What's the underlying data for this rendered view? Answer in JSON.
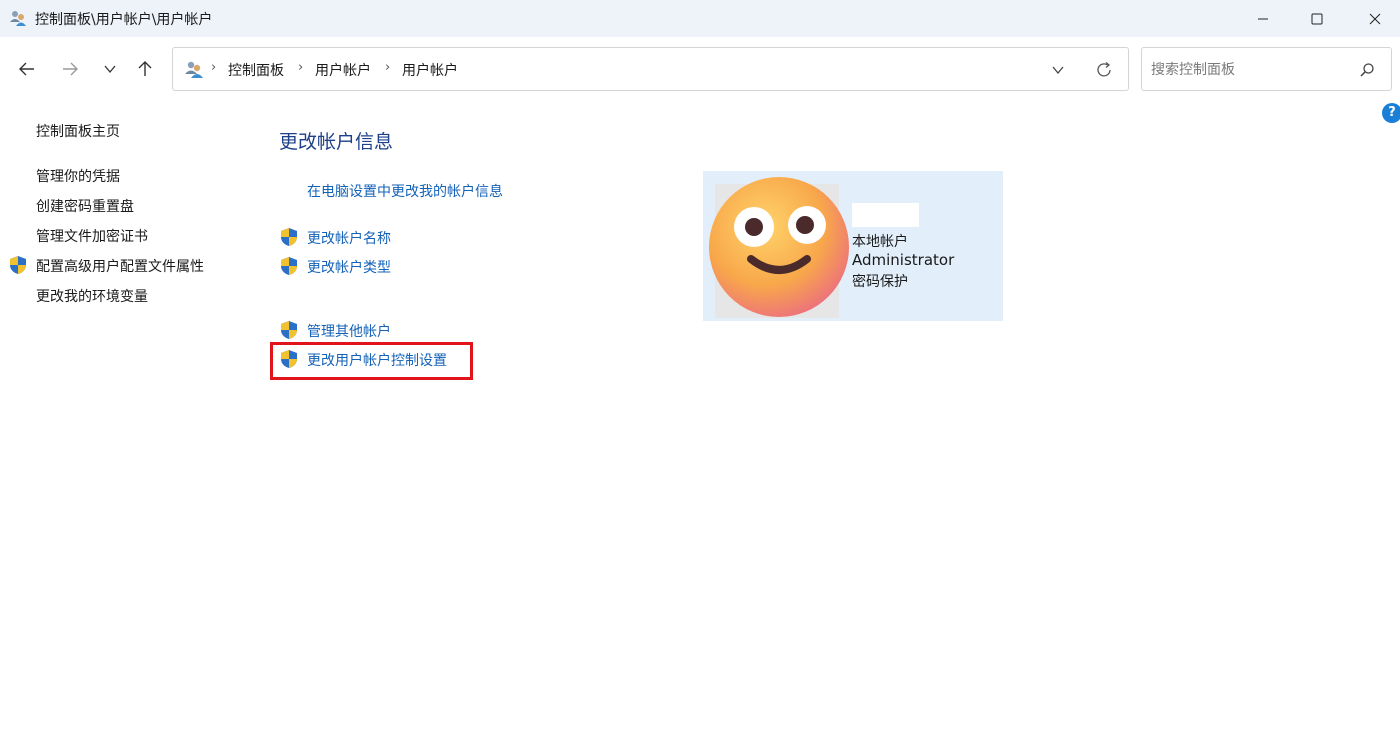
{
  "window": {
    "title": "控制面板\\用户帐户\\用户帐户",
    "controls": [
      "minimize-icon",
      "maximize-icon",
      "close-icon"
    ]
  },
  "nav": {
    "back_icon": "arrow-left-icon",
    "forward_icon": "arrow-right-icon",
    "recent_icon": "chevron-down-icon",
    "up_icon": "arrow-up-icon"
  },
  "address": {
    "crumbs": [
      "控制面板",
      "用户帐户",
      "用户帐户"
    ]
  },
  "search": {
    "placeholder": "搜索控制面板"
  },
  "sidebar": {
    "items": [
      {
        "label": "控制面板主页",
        "shield": false
      },
      {
        "label": "管理你的凭据",
        "shield": false
      },
      {
        "label": "创建密码重置盘",
        "shield": false
      },
      {
        "label": "管理文件加密证书",
        "shield": false
      },
      {
        "label": "配置高级用户配置文件属性",
        "shield": true
      },
      {
        "label": "更改我的环境变量",
        "shield": false
      }
    ]
  },
  "main": {
    "title": "更改帐户信息",
    "links": [
      {
        "label": "在电脑设置中更改我的帐户信息",
        "shield": false
      },
      {
        "label": "更改帐户名称",
        "shield": true
      },
      {
        "label": "更改帐户类型",
        "shield": true
      },
      {
        "label": "管理其他帐户",
        "shield": true
      },
      {
        "label": "更改用户帐户控制设置",
        "shield": true,
        "highlighted": true
      }
    ]
  },
  "account": {
    "type": "本地帐户",
    "role": "Administrator",
    "status": "密码保护"
  },
  "colors": {
    "link": "#1462b8",
    "title": "#1e3f8a",
    "highlight": "#e3131c",
    "card": "#e2effb"
  }
}
